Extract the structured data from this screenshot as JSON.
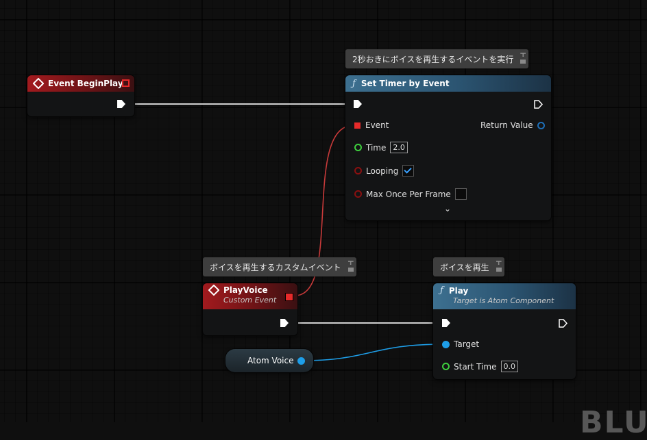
{
  "comments": {
    "timer": "2秒おきにボイスを再生するイベントを実行",
    "custom_event": "ボイスを再生するカスタムイベント",
    "play": "ボイスを再生"
  },
  "event_beginplay": {
    "title": "Event BeginPlay"
  },
  "set_timer": {
    "title": "Set Timer by Event",
    "pin_event": "Event",
    "pin_return": "Return Value",
    "pin_time": "Time",
    "time_value": "2.0",
    "pin_looping": "Looping",
    "looping_checked": true,
    "pin_max_once": "Max Once Per Frame",
    "max_once_checked": false,
    "expand_glyph": "⌄"
  },
  "play_voice": {
    "title": "PlayVoice",
    "subtitle": "Custom Event"
  },
  "play": {
    "title": "Play",
    "subtitle": "Target is Atom Component",
    "pin_target": "Target",
    "pin_start_time": "Start Time",
    "start_time_value": "0.0"
  },
  "atom_voice": {
    "label": "Atom Voice"
  },
  "watermark": "BLU",
  "colors": {
    "event_red": "#a21a1e",
    "function_blue": "#3d7090",
    "object_pin": "#1e9ee8",
    "float_pin": "#3ecf3e",
    "bool_pin": "#8a1010",
    "delegate_pin": "#e62a2a",
    "wire_exec": "#d0d0d0",
    "wire_delegate": "#c83a3a",
    "wire_object": "#1e9ee8"
  },
  "icons": {
    "function": "function-icon",
    "event": "event-diamond-icon",
    "exec": "exec-pin-icon",
    "checkbox": "check-icon",
    "chevron": "chevron-down-icon"
  }
}
